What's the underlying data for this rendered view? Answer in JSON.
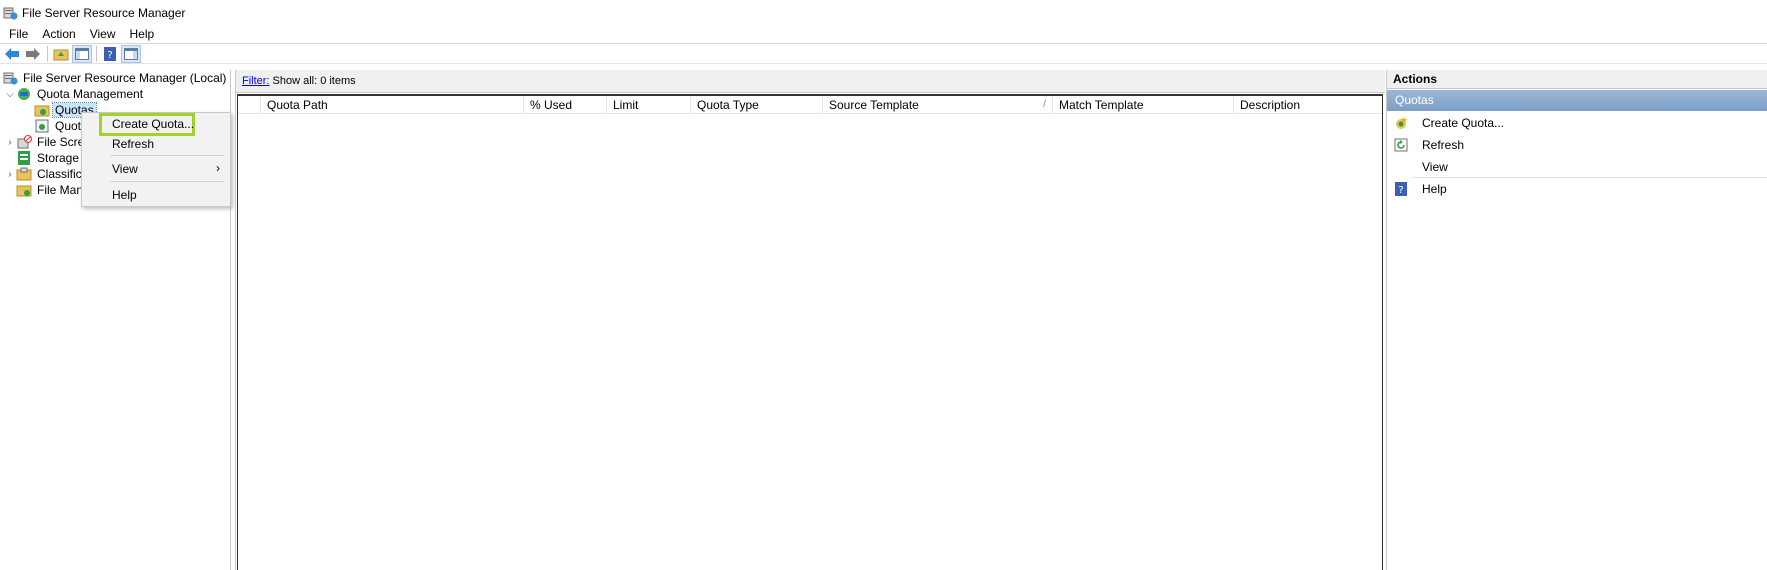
{
  "window": {
    "title": "File Server Resource Manager"
  },
  "menu": {
    "items": [
      "File",
      "Action",
      "View",
      "Help"
    ]
  },
  "tree": {
    "root": "File Server Resource Manager (Local)",
    "quota_management": "Quota Management",
    "quotas": "Quotas",
    "quota_templates": "Quota",
    "file_screening": "File Scree",
    "storage_reports": "Storage R",
    "classification": "Classifica",
    "file_management": "File Mana"
  },
  "context_menu": {
    "create_quota": "Create Quota...",
    "refresh": "Refresh",
    "view": "View",
    "help": "Help",
    "submenu_arrow": "›"
  },
  "center": {
    "filter_label": "Filter:",
    "filter_text": "Show all: 0 items",
    "columns": [
      "Quota Path",
      "% Used",
      "Limit",
      "Quota Type",
      "Source Template",
      "Match Template",
      "Description"
    ],
    "sort_indicator": "/"
  },
  "actions": {
    "header": "Actions",
    "section": "Quotas",
    "items": [
      {
        "label": "Create Quota...",
        "icon": "create-quota-icon"
      },
      {
        "label": "Refresh",
        "icon": "refresh-icon"
      },
      {
        "label": "View",
        "icon": ""
      },
      {
        "label": "Help",
        "icon": "help-icon"
      }
    ]
  },
  "colors": {
    "highlight_border": "#a3d12c",
    "section_bg": "#8aa9cd",
    "link": "#0000ee"
  }
}
